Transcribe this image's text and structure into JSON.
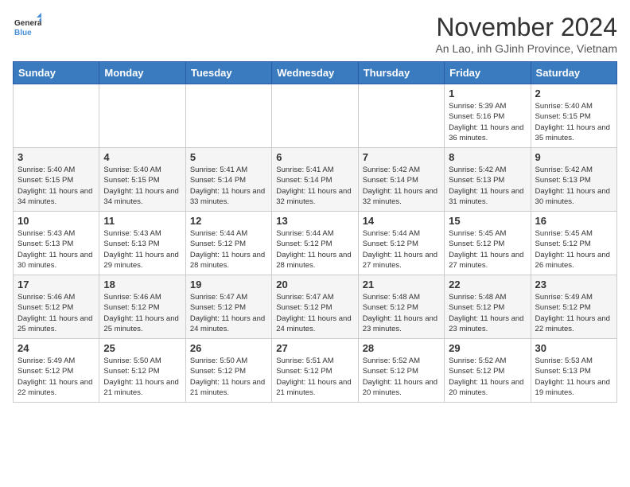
{
  "logo": {
    "general": "General",
    "blue": "Blue"
  },
  "header": {
    "month_year": "November 2024",
    "location": "An Lao, inh GJinh Province, Vietnam"
  },
  "days_of_week": [
    "Sunday",
    "Monday",
    "Tuesday",
    "Wednesday",
    "Thursday",
    "Friday",
    "Saturday"
  ],
  "weeks": [
    [
      {
        "day": "",
        "info": ""
      },
      {
        "day": "",
        "info": ""
      },
      {
        "day": "",
        "info": ""
      },
      {
        "day": "",
        "info": ""
      },
      {
        "day": "",
        "info": ""
      },
      {
        "day": "1",
        "info": "Sunrise: 5:39 AM\nSunset: 5:16 PM\nDaylight: 11 hours and 36 minutes."
      },
      {
        "day": "2",
        "info": "Sunrise: 5:40 AM\nSunset: 5:15 PM\nDaylight: 11 hours and 35 minutes."
      }
    ],
    [
      {
        "day": "3",
        "info": "Sunrise: 5:40 AM\nSunset: 5:15 PM\nDaylight: 11 hours and 34 minutes."
      },
      {
        "day": "4",
        "info": "Sunrise: 5:40 AM\nSunset: 5:15 PM\nDaylight: 11 hours and 34 minutes."
      },
      {
        "day": "5",
        "info": "Sunrise: 5:41 AM\nSunset: 5:14 PM\nDaylight: 11 hours and 33 minutes."
      },
      {
        "day": "6",
        "info": "Sunrise: 5:41 AM\nSunset: 5:14 PM\nDaylight: 11 hours and 32 minutes."
      },
      {
        "day": "7",
        "info": "Sunrise: 5:42 AM\nSunset: 5:14 PM\nDaylight: 11 hours and 32 minutes."
      },
      {
        "day": "8",
        "info": "Sunrise: 5:42 AM\nSunset: 5:13 PM\nDaylight: 11 hours and 31 minutes."
      },
      {
        "day": "9",
        "info": "Sunrise: 5:42 AM\nSunset: 5:13 PM\nDaylight: 11 hours and 30 minutes."
      }
    ],
    [
      {
        "day": "10",
        "info": "Sunrise: 5:43 AM\nSunset: 5:13 PM\nDaylight: 11 hours and 30 minutes."
      },
      {
        "day": "11",
        "info": "Sunrise: 5:43 AM\nSunset: 5:13 PM\nDaylight: 11 hours and 29 minutes."
      },
      {
        "day": "12",
        "info": "Sunrise: 5:44 AM\nSunset: 5:12 PM\nDaylight: 11 hours and 28 minutes."
      },
      {
        "day": "13",
        "info": "Sunrise: 5:44 AM\nSunset: 5:12 PM\nDaylight: 11 hours and 28 minutes."
      },
      {
        "day": "14",
        "info": "Sunrise: 5:44 AM\nSunset: 5:12 PM\nDaylight: 11 hours and 27 minutes."
      },
      {
        "day": "15",
        "info": "Sunrise: 5:45 AM\nSunset: 5:12 PM\nDaylight: 11 hours and 27 minutes."
      },
      {
        "day": "16",
        "info": "Sunrise: 5:45 AM\nSunset: 5:12 PM\nDaylight: 11 hours and 26 minutes."
      }
    ],
    [
      {
        "day": "17",
        "info": "Sunrise: 5:46 AM\nSunset: 5:12 PM\nDaylight: 11 hours and 25 minutes."
      },
      {
        "day": "18",
        "info": "Sunrise: 5:46 AM\nSunset: 5:12 PM\nDaylight: 11 hours and 25 minutes."
      },
      {
        "day": "19",
        "info": "Sunrise: 5:47 AM\nSunset: 5:12 PM\nDaylight: 11 hours and 24 minutes."
      },
      {
        "day": "20",
        "info": "Sunrise: 5:47 AM\nSunset: 5:12 PM\nDaylight: 11 hours and 24 minutes."
      },
      {
        "day": "21",
        "info": "Sunrise: 5:48 AM\nSunset: 5:12 PM\nDaylight: 11 hours and 23 minutes."
      },
      {
        "day": "22",
        "info": "Sunrise: 5:48 AM\nSunset: 5:12 PM\nDaylight: 11 hours and 23 minutes."
      },
      {
        "day": "23",
        "info": "Sunrise: 5:49 AM\nSunset: 5:12 PM\nDaylight: 11 hours and 22 minutes."
      }
    ],
    [
      {
        "day": "24",
        "info": "Sunrise: 5:49 AM\nSunset: 5:12 PM\nDaylight: 11 hours and 22 minutes."
      },
      {
        "day": "25",
        "info": "Sunrise: 5:50 AM\nSunset: 5:12 PM\nDaylight: 11 hours and 21 minutes."
      },
      {
        "day": "26",
        "info": "Sunrise: 5:50 AM\nSunset: 5:12 PM\nDaylight: 11 hours and 21 minutes."
      },
      {
        "day": "27",
        "info": "Sunrise: 5:51 AM\nSunset: 5:12 PM\nDaylight: 11 hours and 21 minutes."
      },
      {
        "day": "28",
        "info": "Sunrise: 5:52 AM\nSunset: 5:12 PM\nDaylight: 11 hours and 20 minutes."
      },
      {
        "day": "29",
        "info": "Sunrise: 5:52 AM\nSunset: 5:12 PM\nDaylight: 11 hours and 20 minutes."
      },
      {
        "day": "30",
        "info": "Sunrise: 5:53 AM\nSunset: 5:13 PM\nDaylight: 11 hours and 19 minutes."
      }
    ]
  ]
}
